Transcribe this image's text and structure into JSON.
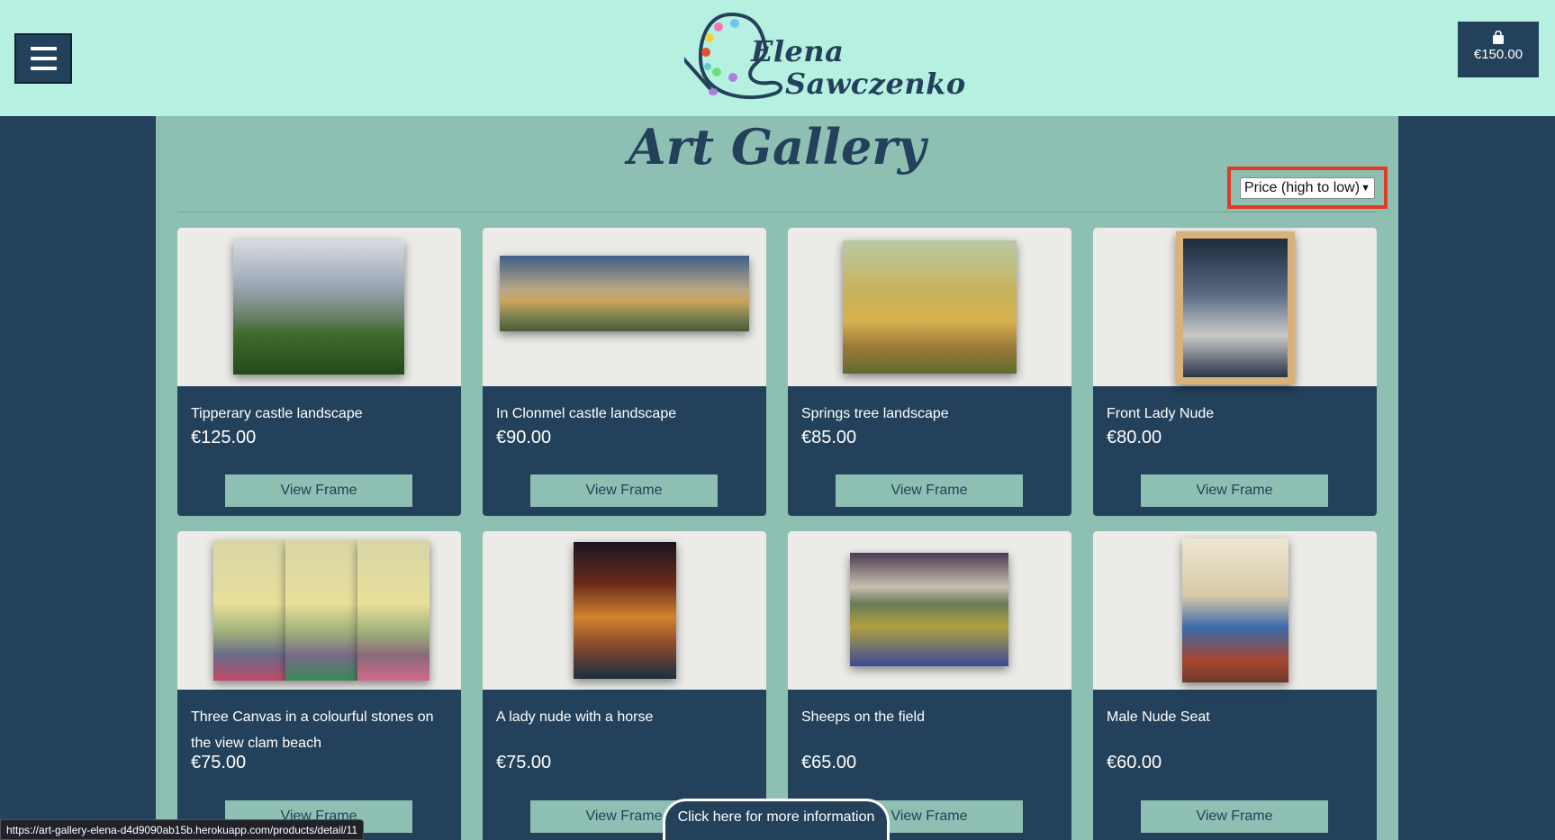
{
  "header": {
    "menu_icon": "hamburger-icon",
    "logo_line1": "Elena",
    "logo_line2": "Sawczenko",
    "cart_icon": "shopping-bag-icon",
    "cart_total": "€150.00"
  },
  "main": {
    "title": "Art Gallery",
    "sort_selected": "Price (high to low)"
  },
  "products": [
    {
      "title": "Tipperary castle landscape",
      "price": "€125.00",
      "button": "View Frame"
    },
    {
      "title": "In Clonmel castle landscape",
      "price": "€90.00",
      "button": "View Frame"
    },
    {
      "title": "Springs tree landscape",
      "price": "€85.00",
      "button": "View Frame"
    },
    {
      "title": "Front Lady Nude",
      "price": "€80.00",
      "button": "View Frame"
    },
    {
      "title": "Three Canvas in a colourful stones on the view clam beach",
      "price": "€75.00",
      "button": "View Frame"
    },
    {
      "title": "A lady nude with a horse",
      "price": "€75.00",
      "button": "View Frame"
    },
    {
      "title": "Sheeps on the field",
      "price": "€65.00",
      "button": "View Frame"
    },
    {
      "title": "Male Nude Seat",
      "price": "€60.00",
      "button": "View Frame"
    }
  ],
  "info_button": "Click here for more information",
  "status_url": "https://art-gallery-elena-d4d9090ab15b.herokuapp.com/products/detail/11",
  "colors": {
    "header_bg": "#b5f0e1",
    "navy": "#23415a",
    "teal": "#8ebfb3",
    "highlight": "#e03a24"
  }
}
